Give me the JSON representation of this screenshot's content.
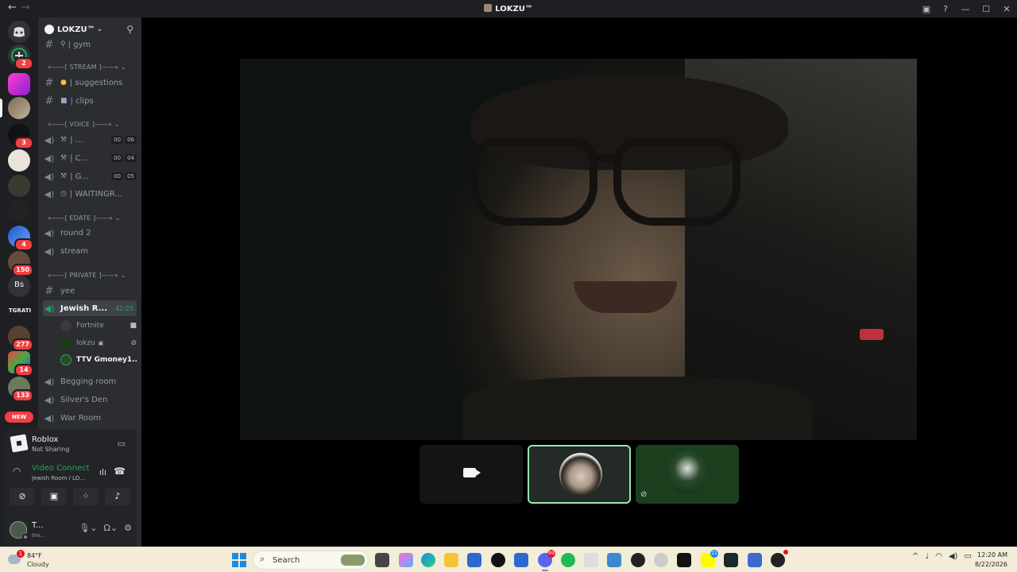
{
  "window": {
    "title": "LOKZU™",
    "back_label": "←",
    "forward_label": "→"
  },
  "guild_badges": [
    "2",
    "3",
    "4",
    "150",
    "277",
    "14",
    "133"
  ],
  "guild_text": {
    "bs": "Bs",
    "tgr": "TGRATI",
    "new_badge": "NEW"
  },
  "server": {
    "name": "LOKZU™",
    "chevron": "⌄"
  },
  "channels": {
    "gym": "| gym",
    "cat_stream": "»——[ STREAM ]——« ⌄",
    "suggestions": "| suggestions",
    "clips": "| clips",
    "cat_voice": "»——[ VOICE ]——« ⌄",
    "v1": "| ...",
    "v1_counts": [
      "00",
      "06"
    ],
    "v2": "| C...",
    "v2_counts": [
      "00",
      "04"
    ],
    "v3": "| G...",
    "v3_counts": [
      "00",
      "05"
    ],
    "v4": "| WAITINGR...",
    "cat_edate": "»——[ EDATE ]——« ⌄",
    "round2": "round 2",
    "stream": "stream",
    "cat_private": "»——[ PRIVATE ]——« ⌄",
    "yee": "yee",
    "active": "Jewish R...",
    "active_timer": "42:25",
    "members": [
      {
        "name": "Fortnite"
      },
      {
        "name": "lokzu"
      },
      {
        "name": "TTV Gmoney1..."
      }
    ],
    "begging": "Begging room",
    "silver": "Silver's Den",
    "war": "War Room"
  },
  "voice_panel": {
    "activity_name": "Roblox",
    "activity_status": "Not Sharing",
    "connection": "Video Connecte",
    "location": "Jewish Room / LO..."
  },
  "user": {
    "name": "T...",
    "status": "Inv..."
  },
  "taskbar": {
    "temp": "84°F",
    "condition": "Cloudy",
    "weather_badge": "1",
    "search_placeholder": "Search",
    "discord_badge": "99",
    "snap_badge": "21",
    "time": "12:20 AM",
    "date": "8/22/2026"
  },
  "colors": {
    "accent_green": "#23a55a",
    "badge_red": "#f23f43",
    "sidebar": "#2b2d31",
    "rail": "#1e1f22"
  }
}
